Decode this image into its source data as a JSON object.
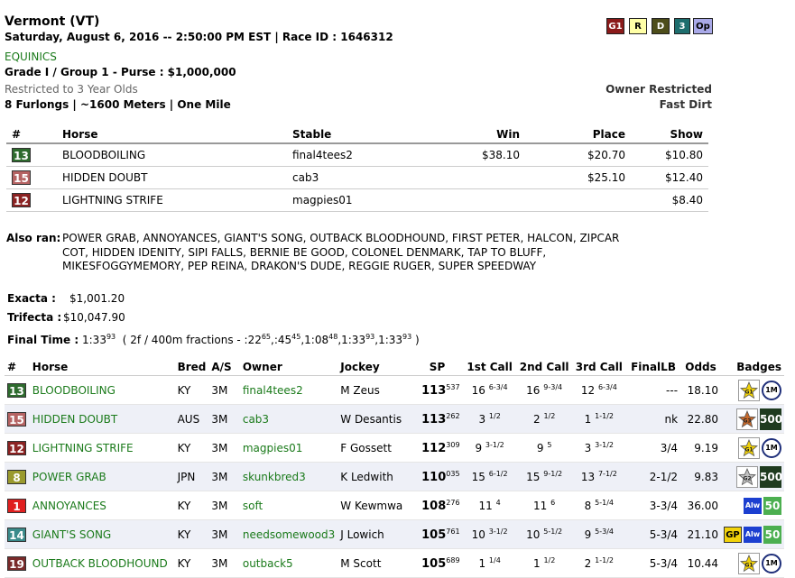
{
  "race": {
    "track": "Vermont (VT)",
    "date_line": "Saturday, August 6, 2016 -- 2:50:00 PM EST | Race ID : 1646312",
    "sponsor": "EQUINICS",
    "grade_purse": "Grade I / Group 1 - Purse : $1,000,000",
    "restriction": "Restricted to 3 Year Olds",
    "distance": "8 Furlongs | ~1600 Meters | One Mile",
    "owner_restricted": "Owner Restricted",
    "surface": "Fast Dirt"
  },
  "flags": [
    {
      "label": "G1",
      "bg": "#8b1a1a",
      "fg": "#ffffff"
    },
    {
      "label": "R",
      "bg": "#ffffa6",
      "fg": "#000000"
    },
    {
      "label": "D",
      "bg": "#4d4d1a",
      "fg": "#ffffff"
    },
    {
      "label": "3",
      "bg": "#1e6e6e",
      "fg": "#ffffff"
    },
    {
      "label": "Op",
      "bg": "#a9a9e8",
      "fg": "#000000"
    }
  ],
  "payouts": {
    "headers": {
      "num": "#",
      "horse": "Horse",
      "stable": "Stable",
      "win": "Win",
      "place": "Place",
      "show": "Show"
    },
    "rows": [
      {
        "num": "13",
        "color": "#2e6b2e",
        "horse": "BLOODBOILING",
        "stable": "final4tees2",
        "win": "$38.10",
        "place": "$20.70",
        "show": "$10.80"
      },
      {
        "num": "15",
        "color": "#b56363",
        "horse": "HIDDEN DOUBT",
        "stable": "cab3",
        "win": "",
        "place": "$25.10",
        "show": "$12.40"
      },
      {
        "num": "12",
        "color": "#8b2222",
        "horse": "LIGHTNING STRIFE",
        "stable": "magpies01",
        "win": "",
        "place": "",
        "show": "$8.40"
      }
    ]
  },
  "also_ran": {
    "label": "Also ran:",
    "lines": [
      "POWER GRAB, ANNOYANCES, GIANT'S SONG, OUTBACK BLOODHOUND, FIRST PETER, HALCON, ZIPCAR",
      "COT, HIDDEN IDENITY, SIPI FALLS, BERNIE BE GOOD, COLONEL DENMARK, TAP TO BLUFF,",
      "MIKESFOGGYMEMORY, PEP REINA, DRAKON'S DUDE, REGGIE RUGER, SUPER SPEEDWAY"
    ]
  },
  "exotics": {
    "exacta_label": "Exacta :",
    "exacta_value": "$1,001.20",
    "trifecta_label": "Trifecta :",
    "trifecta_value": "$10,047.90"
  },
  "final_time": {
    "label": "Final Time :",
    "time": "1:33",
    "time_sup": "93",
    "fractions_prefix": "( 2f / 400m fractions - :22",
    "f1": "65",
    "s2": ",:45",
    "f2": "45",
    "s3": ",1:08",
    "f3": "48",
    "s4": ",1:33",
    "f4": "93",
    "s5": ",1:33",
    "f5": "93",
    "suffix": " )"
  },
  "results": {
    "headers": [
      "#",
      "Horse",
      "Bred",
      "A/S",
      "Owner",
      "Jockey",
      "SP",
      "1st Call",
      "2nd Call",
      "3rd Call",
      "FinalLB",
      "Odds",
      "Badges"
    ],
    "rows": [
      {
        "num": "13",
        "color": "#2e6b2e",
        "horse": "BLOODBOILING",
        "bred": "KY",
        "as": "3M",
        "owner": "final4tees2",
        "jockey": "M Zeus",
        "sp": "113",
        "sp_sup": "537",
        "c1": "16",
        "c1s": "6-3/4",
        "c2": "16",
        "c2s": "9-3/4",
        "c3": "12",
        "c3s": "6-3/4",
        "lb": "---",
        "odds": "18.10",
        "badges": [
          {
            "type": "star",
            "label": "G1",
            "color": "#f1d20a"
          },
          {
            "type": "circle",
            "label": "1M"
          }
        ]
      },
      {
        "num": "15",
        "color": "#b56363",
        "horse": "HIDDEN DOUBT",
        "bred": "AUS",
        "as": "3M",
        "owner": "cab3",
        "jockey": "W Desantis",
        "sp": "113",
        "sp_sup": "262",
        "c1": "3",
        "c1s": "1/2",
        "c2": "2",
        "c2s": "1/2",
        "c3": "1",
        "c3s": "1-1/2",
        "lb": "nk",
        "odds": "22.80",
        "badges": [
          {
            "type": "star",
            "label": "G3",
            "color": "#c8692a"
          },
          {
            "type": "500",
            "label": "500"
          }
        ]
      },
      {
        "num": "12",
        "color": "#8b2222",
        "horse": "LIGHTNING STRIFE",
        "bred": "KY",
        "as": "3M",
        "owner": "magpies01",
        "jockey": "F Gossett",
        "sp": "112",
        "sp_sup": "309",
        "c1": "9",
        "c1s": "3-1/2",
        "c2": "9",
        "c2s": "5",
        "c3": "3",
        "c3s": "3-1/2",
        "lb": "3/4",
        "odds": "9.19",
        "badges": [
          {
            "type": "star",
            "label": "G1",
            "color": "#f1d20a"
          },
          {
            "type": "circle",
            "label": "1M"
          }
        ]
      },
      {
        "num": "8",
        "color": "#9a9a2e",
        "horse": "POWER GRAB",
        "bred": "JPN",
        "as": "3M",
        "owner": "skunkbred3",
        "jockey": "K Ledwith",
        "sp": "110",
        "sp_sup": "035",
        "c1": "15",
        "c1s": "6-1/2",
        "c2": "15",
        "c2s": "9-1/2",
        "c3": "13",
        "c3s": "7-1/2",
        "lb": "2-1/2",
        "odds": "9.83",
        "badges": [
          {
            "type": "star",
            "label": "G2",
            "color": "#c0c0c0"
          },
          {
            "type": "500",
            "label": "500"
          }
        ]
      },
      {
        "num": "1",
        "color": "#e02020",
        "horse": "ANNOYANCES",
        "bred": "KY",
        "as": "3M",
        "owner": "soft",
        "jockey": "W Kewmwa",
        "sp": "108",
        "sp_sup": "276",
        "c1": "11",
        "c1s": "4",
        "c2": "11",
        "c2s": "6",
        "c3": "8",
        "c3s": "5-1/4",
        "lb": "3-3/4",
        "odds": "36.00",
        "badges": [
          {
            "type": "alw",
            "label": "Alw"
          },
          {
            "type": "50",
            "label": "50"
          }
        ]
      },
      {
        "num": "14",
        "color": "#3a8a8a",
        "horse": "GIANT'S SONG",
        "bred": "KY",
        "as": "3M",
        "owner": "needsomewood3",
        "jockey": "J Lowich",
        "sp": "105",
        "sp_sup": "761",
        "c1": "10",
        "c1s": "3-1/2",
        "c2": "10",
        "c2s": "5-1/2",
        "c3": "9",
        "c3s": "5-3/4",
        "lb": "5-3/4",
        "odds": "21.10",
        "badges": [
          {
            "type": "gp",
            "label": "GP"
          },
          {
            "type": "alw",
            "label": "Alw"
          },
          {
            "type": "50",
            "label": "50"
          }
        ]
      },
      {
        "num": "19",
        "color": "#7a2a2a",
        "horse": "OUTBACK BLOODHOUND",
        "bred": "KY",
        "as": "3M",
        "owner": "outback5",
        "jockey": "M Scott",
        "sp": "105",
        "sp_sup": "689",
        "c1": "1",
        "c1s": "1/4",
        "c2": "1",
        "c2s": "1/2",
        "c3": "2",
        "c3s": "1-1/2",
        "lb": "5-3/4",
        "odds": "10.44",
        "badges": [
          {
            "type": "star",
            "label": "G1",
            "color": "#f1d20a"
          },
          {
            "type": "circle",
            "label": "1M"
          }
        ]
      }
    ]
  }
}
